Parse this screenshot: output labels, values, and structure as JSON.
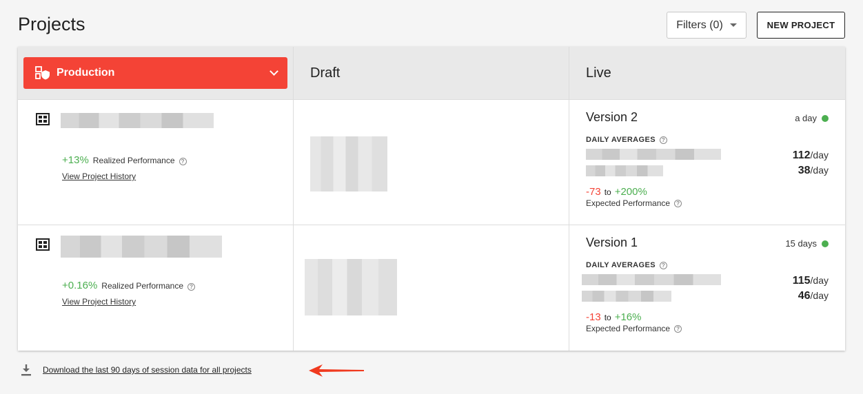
{
  "header": {
    "title": "Projects",
    "filters_label": "Filters (0)",
    "new_project_label": "NEW PROJECT"
  },
  "columns": {
    "environment": "Production",
    "draft": "Draft",
    "live": "Live"
  },
  "projects": [
    {
      "performance_pct": "+13%",
      "performance_label": "Realized Performance",
      "history_link": "View Project History",
      "version": "Version 2",
      "age": "a day",
      "daily_averages_label": "DAILY AVERAGES",
      "rates": [
        {
          "value": "112",
          "unit": "/day"
        },
        {
          "value": "38",
          "unit": "/day"
        }
      ],
      "expected_low": "-73",
      "expected_to": "to",
      "expected_high": "+200%",
      "expected_label": "Expected Performance"
    },
    {
      "performance_pct": "+0.16%",
      "performance_label": "Realized Performance",
      "history_link": "View Project History",
      "version": "Version 1",
      "age": "15 days",
      "daily_averages_label": "DAILY AVERAGES",
      "rates": [
        {
          "value": "115",
          "unit": "/day"
        },
        {
          "value": "46",
          "unit": "/day"
        }
      ],
      "expected_low": "-13",
      "expected_to": "to",
      "expected_high": "+16%",
      "expected_label": "Expected Performance"
    }
  ],
  "footer": {
    "download_link": "Download the last 90 days of session data for all projects"
  },
  "colors": {
    "accent": "#f44336",
    "positive": "#4caf50",
    "status_live": "#4caf50"
  },
  "icons": {
    "environment": "environment-shield-icon",
    "project": "project-board-icon",
    "download": "download-icon",
    "filters_caret": "caret-down-icon"
  }
}
